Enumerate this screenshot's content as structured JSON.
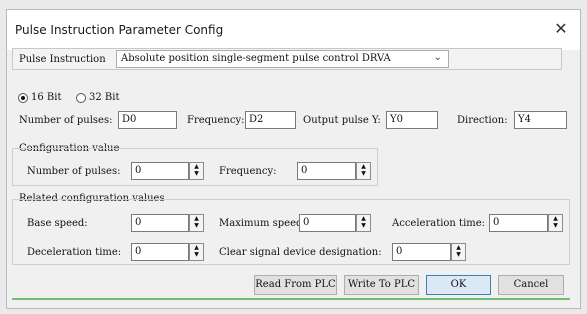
{
  "window": {
    "title": "Pulse Instruction Parameter Config",
    "close_glyph": "✕"
  },
  "instruction": {
    "label": "Pulse Instruction",
    "selected": "Absolute position single-segment pulse control  DRVA",
    "dropdown_glyph": "⌄"
  },
  "bit_mode": {
    "options": [
      "16 Bit",
      "32 Bit"
    ],
    "selected": "16 Bit"
  },
  "params": {
    "pulses_label": "Number of pulses:",
    "pulses_value": "D0",
    "frequency_label": "Frequency:",
    "frequency_value": "D2",
    "output_label": "Output pulse Y:",
    "output_value": "Y0",
    "direction_label": "Direction:",
    "direction_value": "Y4"
  },
  "config": {
    "title": "Configuration value",
    "pulses_label": "Number of pulses:",
    "pulses_value": "0",
    "frequency_label": "Frequency:",
    "frequency_value": "0"
  },
  "related": {
    "title": "Related configuration values",
    "base_speed_label": "Base speed:",
    "base_speed_value": "0",
    "max_speed_label": "Maximum speed:",
    "max_speed_value": "0",
    "accel_label": "Acceleration time:",
    "accel_value": "0",
    "decel_label": "Deceleration time:",
    "decel_value": "0",
    "clear_label": "Clear signal device designation:",
    "clear_value": "0"
  },
  "spin_glyphs": {
    "up": "▲",
    "down": "▼"
  },
  "buttons": {
    "read": "Read From PLC",
    "write": "Write To PLC",
    "ok": "OK",
    "cancel": "Cancel"
  }
}
